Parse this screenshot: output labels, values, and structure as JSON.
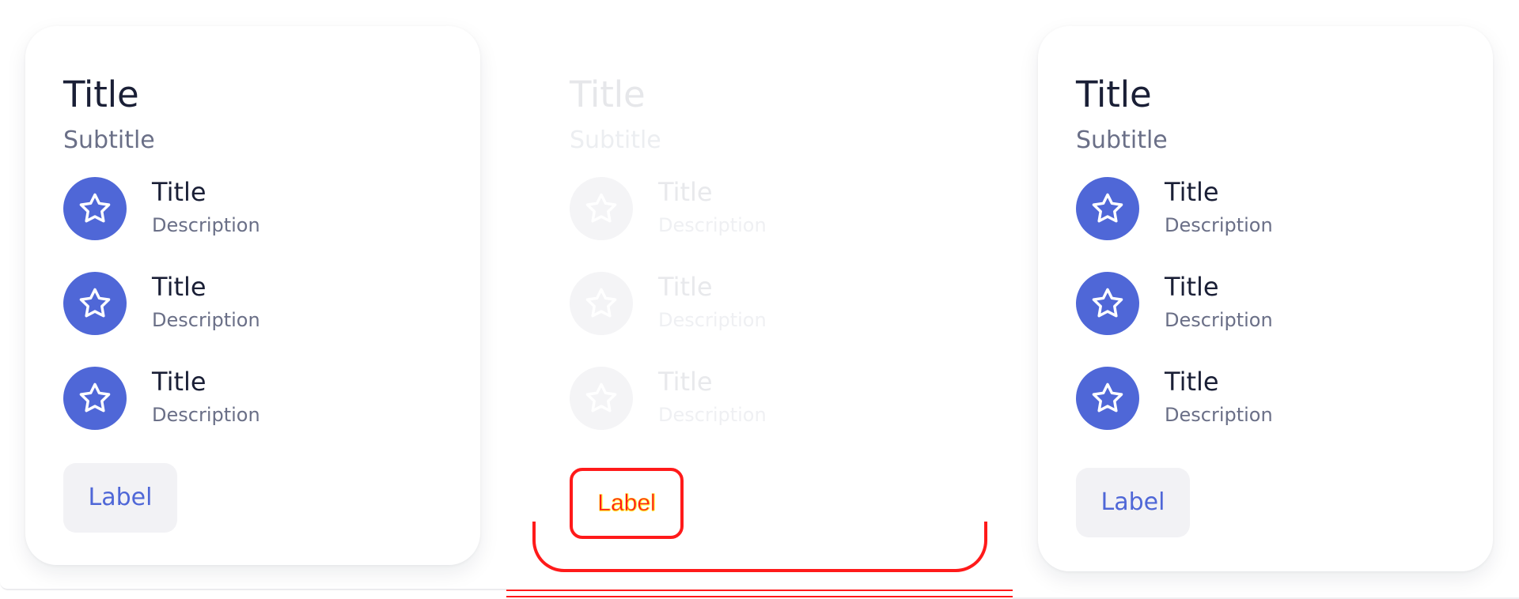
{
  "cards": [
    {
      "title": "Title",
      "subtitle": "Subtitle",
      "items": [
        {
          "title": "Title",
          "description": "Description"
        },
        {
          "title": "Title",
          "description": "Description"
        },
        {
          "title": "Title",
          "description": "Description"
        }
      ],
      "button": {
        "label": "Label"
      }
    },
    {
      "title": "Title",
      "subtitle": "Subtitle",
      "items": [
        {
          "title": "Title",
          "description": "Description"
        },
        {
          "title": "Title",
          "description": "Description"
        },
        {
          "title": "Title",
          "description": "Description"
        }
      ],
      "button": {
        "label": "Label"
      }
    },
    {
      "title": "Title",
      "subtitle": "Subtitle",
      "items": [
        {
          "title": "Title",
          "description": "Description"
        },
        {
          "title": "Title",
          "description": "Description"
        },
        {
          "title": "Title",
          "description": "Description"
        }
      ],
      "button": {
        "label": "Label"
      }
    }
  ],
  "theme": {
    "accent": "#4f67d7",
    "text_primary": "#1a1f36",
    "text_secondary": "#6a6f87",
    "button_bg": "#f2f2f5",
    "disabled_text": "#e8e9ec",
    "highlight_red": "#ff1a1a",
    "highlight_yellow": "#ffef33"
  },
  "icons": {
    "list_item_icon": "star-icon"
  }
}
